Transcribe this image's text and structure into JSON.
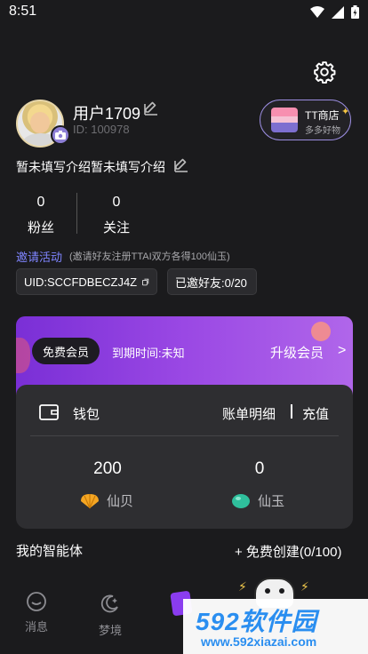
{
  "status_bar": {
    "time": "8:51"
  },
  "profile": {
    "username": "用户1709",
    "id_label": "ID: 100978",
    "intro": "暂未填写介绍暂未填写介绍"
  },
  "shop": {
    "title": "TT商店",
    "subtitle": "多多好物"
  },
  "stats": {
    "fans_count": "0",
    "fans_label": "粉丝",
    "follow_count": "0",
    "follow_label": "关注"
  },
  "invite": {
    "title": "邀请活动",
    "description": "(邀请好友注册TTAI双方各得100仙玉)",
    "uid_text": "UID:SCCFDBECZJ4Z",
    "invited_text": "已邀好友:0/20"
  },
  "membership": {
    "badge": "免费会员",
    "expire": "到期时间:未知",
    "upgrade": "升级会员",
    "chevron": ">"
  },
  "wallet": {
    "title": "钱包",
    "bill_label": "账单明细",
    "recharge_label": "充值",
    "xianbei_value": "200",
    "xianbei_label": "仙贝",
    "xianyu_value": "0",
    "xianyu_label": "仙玉"
  },
  "agents": {
    "title": "我的智能体",
    "create": "+ 免费创建(0/100)"
  },
  "nav": {
    "messages": "消息",
    "dreamland": "梦境"
  },
  "watermark": {
    "logo_num": "592",
    "logo_cn": "软件园",
    "url": "www.592xiazai.com"
  },
  "colors": {
    "background": "#1b1b1d",
    "accent": "#7f85ff",
    "vip_purple": "#9a48e4"
  }
}
